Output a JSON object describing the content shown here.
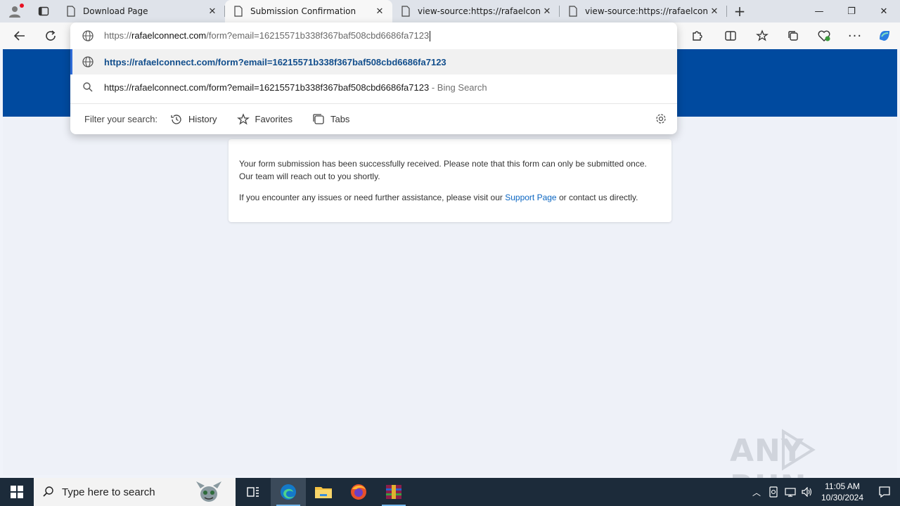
{
  "browser": {
    "tabs": [
      {
        "title": "Download Page",
        "active": false
      },
      {
        "title": "Submission Confirmation",
        "active": true
      },
      {
        "title": "view-source:https://rafaelconnect.com",
        "active": false
      },
      {
        "title": "view-source:https://rafaelconnect.com",
        "active": false
      }
    ],
    "omnibox": {
      "url_scheme": "https://",
      "url_host": "rafaelconnect.com",
      "url_path": "/form?email=16215571b338f367baf508cbd6686fa7123",
      "suggestions": [
        {
          "text": "https://rafaelconnect.com/form?email=16215571b338f367baf508cbd6686fa7123",
          "suffix": "",
          "icon": "globe-icon",
          "selected": true
        },
        {
          "text": "https://rafaelconnect.com/form?email=16215571b338f367baf508cbd6686fa7123",
          "suffix": " - Bing Search",
          "icon": "search-icon",
          "selected": false
        }
      ],
      "filter_label": "Filter your search:",
      "filters": [
        "History",
        "Favorites",
        "Tabs"
      ]
    }
  },
  "page": {
    "message1": "Your form submission has been successfully received. Please note that this form can only be submitted once. Our team will reach out to you shortly.",
    "message2_before": "If you encounter any issues or need further assistance, please visit our ",
    "support_link": "Support Page",
    "message2_after": " or contact us directly."
  },
  "watermark": {
    "text": "ANY RUN"
  },
  "taskbar": {
    "search_placeholder": "Type here to search",
    "time": "11:05 AM",
    "date": "10/30/2024"
  },
  "colors": {
    "banner": "#004a9f",
    "taskbar": "#1c2b3a",
    "link": "#0b66c2",
    "selected_suggestion": "#124e8c"
  }
}
